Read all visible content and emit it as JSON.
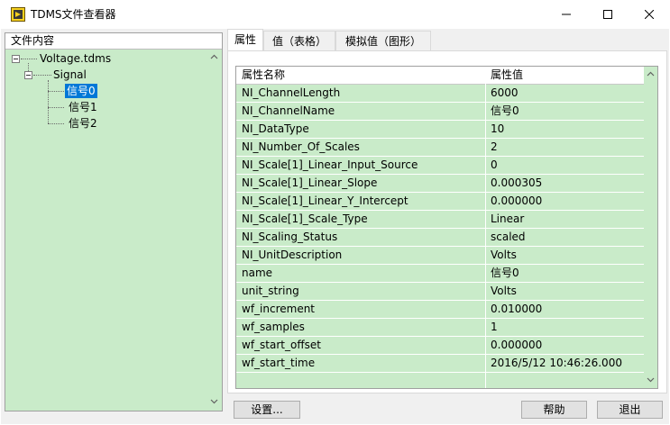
{
  "window": {
    "title": "TDMS文件查看器",
    "icon": "labview-app-icon"
  },
  "tree": {
    "header": "文件内容",
    "file": "Voltage.tdms",
    "group": "Signal",
    "channels": [
      "信号0",
      "信号1",
      "信号2"
    ],
    "selected_channel": "信号0"
  },
  "tabs": [
    {
      "label": "属性",
      "active": true
    },
    {
      "label": "值（表格）",
      "active": false
    },
    {
      "label": "模拟值（图形）",
      "active": false
    }
  ],
  "properties": {
    "columns": [
      "属性名称",
      "属性值"
    ],
    "rows": [
      {
        "name": "NI_ChannelLength",
        "value": "6000"
      },
      {
        "name": "NI_ChannelName",
        "value": "信号0"
      },
      {
        "name": "NI_DataType",
        "value": "10"
      },
      {
        "name": "NI_Number_Of_Scales",
        "value": "2"
      },
      {
        "name": "NI_Scale[1]_Linear_Input_Source",
        "value": "0"
      },
      {
        "name": "NI_Scale[1]_Linear_Slope",
        "value": "0.000305"
      },
      {
        "name": "NI_Scale[1]_Linear_Y_Intercept",
        "value": "0.000000"
      },
      {
        "name": "NI_Scale[1]_Scale_Type",
        "value": "Linear"
      },
      {
        "name": "NI_Scaling_Status",
        "value": "scaled"
      },
      {
        "name": "NI_UnitDescription",
        "value": "Volts"
      },
      {
        "name": "name",
        "value": "信号0"
      },
      {
        "name": "unit_string",
        "value": "Volts"
      },
      {
        "name": "wf_increment",
        "value": "0.010000"
      },
      {
        "name": "wf_samples",
        "value": "1"
      },
      {
        "name": "wf_start_offset",
        "value": "0.000000"
      },
      {
        "name": "wf_start_time",
        "value": "2016/5/12 10:46:26.000"
      }
    ]
  },
  "buttons": {
    "settings": "设置...",
    "help": "帮助",
    "exit": "退出"
  },
  "colors": {
    "panel_bg": "#f0f0f0",
    "list_green": "#c9ebc9",
    "selection_blue": "#0078d7"
  }
}
